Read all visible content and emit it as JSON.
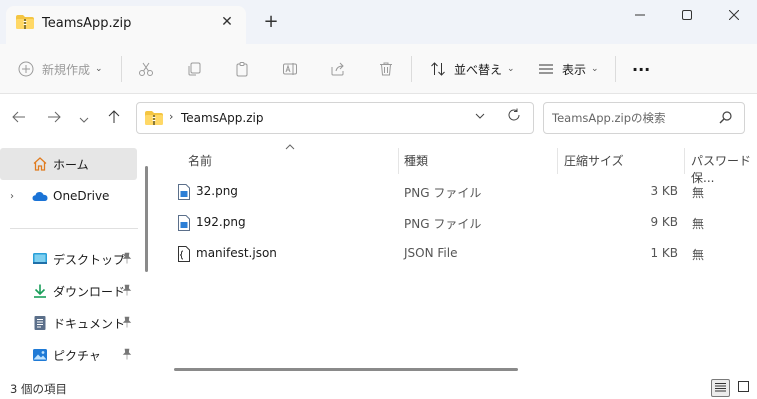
{
  "window": {
    "tab_title": "TeamsApp.zip",
    "close_tab": "✕",
    "new_tab": "+"
  },
  "commandbar": {
    "new_label": "新規作成",
    "sort_label": "並べ替え",
    "view_label": "表示",
    "more_label": "···"
  },
  "address": {
    "path": "TeamsApp.zip",
    "separator": "›",
    "search_placeholder": "TeamsApp.zipの検索"
  },
  "nav": {
    "items": [
      {
        "label": "ホーム"
      },
      {
        "label": "OneDrive"
      },
      {
        "label": "デスクトップ"
      },
      {
        "label": "ダウンロード"
      },
      {
        "label": "ドキュメント"
      },
      {
        "label": "ピクチャ"
      }
    ],
    "expand": "›",
    "pin": "📌"
  },
  "columns": {
    "name": "名前",
    "type": "種類",
    "compressed_size": "圧縮サイズ",
    "password": "パスワード保..."
  },
  "files": [
    {
      "name": "32.png",
      "type": "PNG ファイル",
      "size": "3 KB",
      "password": "無"
    },
    {
      "name": "192.png",
      "type": "PNG ファイル",
      "size": "9 KB",
      "password": "無"
    },
    {
      "name": "manifest.json",
      "type": "JSON File",
      "size": "1 KB",
      "password": "無"
    }
  ],
  "status": {
    "item_count": "3 個の項目"
  },
  "colors": {
    "accent": "#0067c0",
    "folder_yellow": "#f4c542",
    "titlebar_bg": "#f0f3f9"
  }
}
